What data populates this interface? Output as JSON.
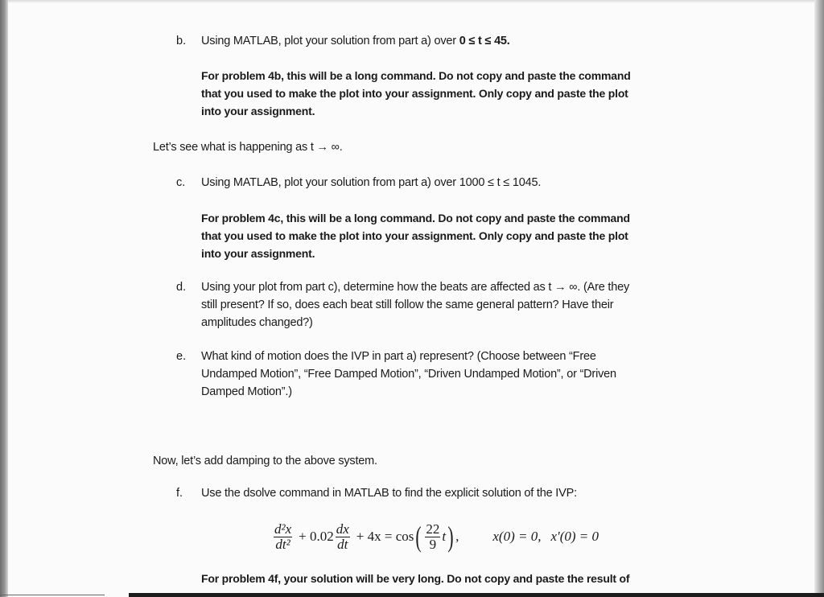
{
  "document": {
    "part_b": {
      "label": "b.",
      "question": "Using MATLAB, plot your solution from part a) over ",
      "range": "0 ≤ t ≤ 45.",
      "note_lines": [
        "For problem 4b, this will be a long command.  Do not copy and paste the command",
        "that you used to make the plot into your assignment.  Only copy and paste the plot",
        "into your assignment."
      ]
    },
    "transition_1": "Let’s see what is happening as t → ∞.",
    "part_c": {
      "label": "c.",
      "question": "Using MATLAB, plot your solution from part a) over ",
      "range": "1000 ≤ t ≤ 1045.",
      "note_lines": [
        "For problem 4c, this will be a long command.  Do not copy and paste the command",
        "that you used to make the plot into your assignment.  Only copy and paste the plot",
        "into your assignment."
      ]
    },
    "part_d": {
      "label": "d.",
      "lines": [
        "Using your plot from part c), determine how the beats are affected as t → ∞.  (Are they",
        "still present?  If so, does each beat still follow the same general pattern?  Have their",
        "amplitudes changed?)"
      ]
    },
    "part_e": {
      "label": "e.",
      "lines": [
        "What kind of motion does the IVP in part a) represent?  (Choose between “Free",
        "Undamped Motion”, “Free Damped Motion”, “Driven Undamped Motion”, or “Driven",
        "Damped Motion”.)"
      ]
    },
    "transition_2": "Now, let’s add damping to the above system.",
    "part_f": {
      "label": "f.",
      "question": "Use the dsolve command in MATLAB to find the explicit solution of the IVP:",
      "equation": {
        "term1_num": "d²x",
        "term1_den": "dt²",
        "plus1": "+ 0.02",
        "term2_num": "dx",
        "term2_den": "dt",
        "rest": "+ 4x = cos",
        "arg_num": "22",
        "arg_den": "9",
        "arg_var": "t",
        "comma": ",",
        "ic1": "x(0) = 0,",
        "ic2": "x′(0) = 0"
      },
      "note_partial": "For problem 4f, your solution will be very long.  Do not copy and paste the result of"
    }
  }
}
